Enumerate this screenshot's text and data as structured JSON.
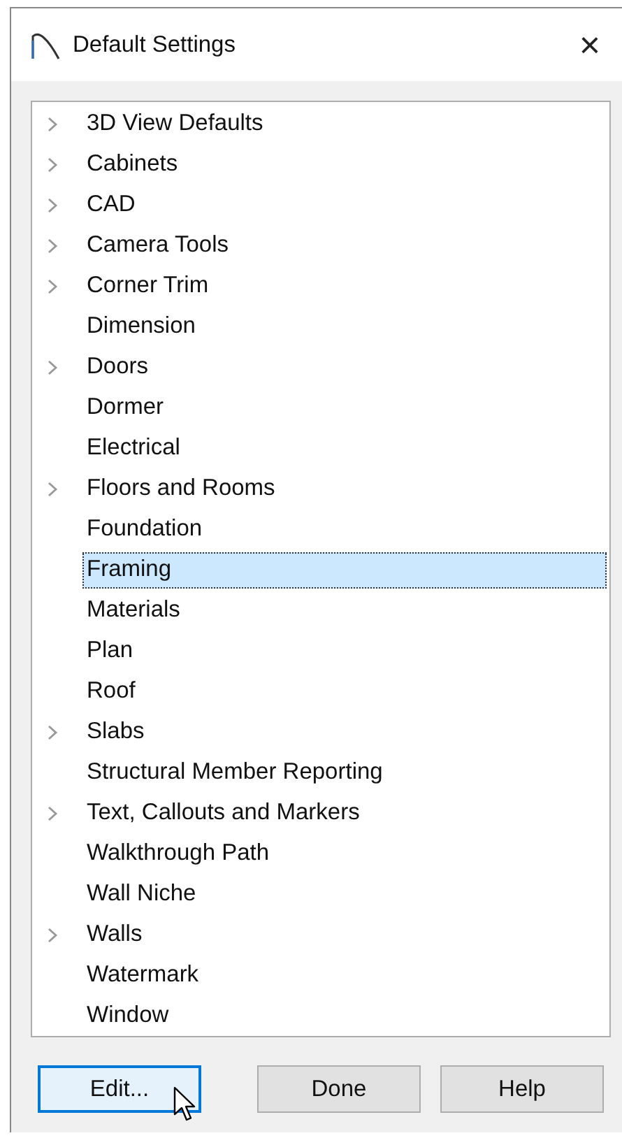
{
  "window": {
    "title": "Default Settings",
    "close": "×"
  },
  "tree": {
    "items": [
      {
        "label": "3D View Defaults",
        "expandable": true,
        "selected": false
      },
      {
        "label": "Cabinets",
        "expandable": true,
        "selected": false
      },
      {
        "label": "CAD",
        "expandable": true,
        "selected": false
      },
      {
        "label": "Camera Tools",
        "expandable": true,
        "selected": false
      },
      {
        "label": "Corner Trim",
        "expandable": true,
        "selected": false
      },
      {
        "label": "Dimension",
        "expandable": false,
        "selected": false
      },
      {
        "label": "Doors",
        "expandable": true,
        "selected": false
      },
      {
        "label": "Dormer",
        "expandable": false,
        "selected": false
      },
      {
        "label": "Electrical",
        "expandable": false,
        "selected": false
      },
      {
        "label": "Floors and Rooms",
        "expandable": true,
        "selected": false
      },
      {
        "label": "Foundation",
        "expandable": false,
        "selected": false
      },
      {
        "label": "Framing",
        "expandable": false,
        "selected": true
      },
      {
        "label": "Materials",
        "expandable": false,
        "selected": false
      },
      {
        "label": "Plan",
        "expandable": false,
        "selected": false
      },
      {
        "label": "Roof",
        "expandable": false,
        "selected": false
      },
      {
        "label": "Slabs",
        "expandable": true,
        "selected": false
      },
      {
        "label": "Structural Member Reporting",
        "expandable": false,
        "selected": false
      },
      {
        "label": "Text, Callouts and Markers",
        "expandable": true,
        "selected": false
      },
      {
        "label": "Walkthrough Path",
        "expandable": false,
        "selected": false
      },
      {
        "label": "Wall Niche",
        "expandable": false,
        "selected": false
      },
      {
        "label": "Walls",
        "expandable": true,
        "selected": false
      },
      {
        "label": "Watermark",
        "expandable": false,
        "selected": false
      },
      {
        "label": "Window",
        "expandable": false,
        "selected": false
      }
    ]
  },
  "buttons": [
    {
      "label": "Edit...",
      "hovered": true
    },
    {
      "label": "Done",
      "hovered": false
    },
    {
      "label": "Help",
      "hovered": false
    }
  ]
}
